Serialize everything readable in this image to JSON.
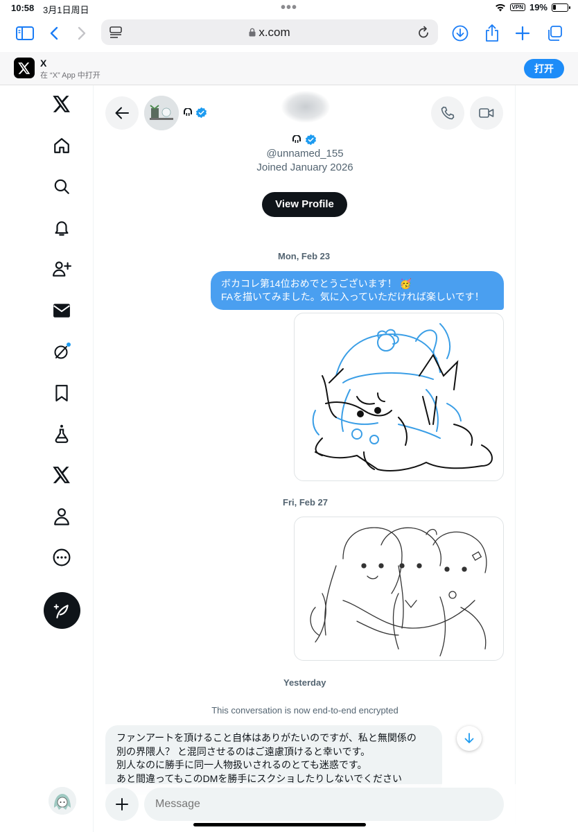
{
  "status": {
    "time": "10:58",
    "date": "3月1日周日",
    "vpn": "VPN",
    "battery": "19%"
  },
  "browser": {
    "url": "x.com"
  },
  "banner": {
    "app_name": "X",
    "subtitle": "在 “X” App 中打开",
    "open_label": "打开"
  },
  "sidebar": {
    "items": [
      "x-logo",
      "home",
      "search",
      "notifications",
      "follow",
      "messages",
      "grok",
      "bookmarks",
      "labs",
      "premium",
      "profile",
      "more"
    ]
  },
  "conversation": {
    "handle": "@unnamed_155",
    "joined": "Joined January 2026",
    "view_profile": "View Profile",
    "dates": {
      "first": "Mon, Feb 23",
      "second": "Fri, Feb 27",
      "third": "Yesterday"
    },
    "sent_message": {
      "line1": "ボカコレ第14位おめでとうございます！ 🥳",
      "line2": "FAを描いてみました。気に入っていただければ楽しいです！"
    },
    "encryption_notice": "This conversation is now end-to-end encrypted",
    "received_message": {
      "line1": "ファンアートを頂けること自体はありがたいのですが、私と無関係の",
      "line2": "別の界隈人？ と混同させるのはご遠慮頂けると幸いです。",
      "line3": "別人なのに勝手に同一人物扱いされるのとても迷惑です。",
      "line4": "あと間違ってもこのDMを勝手にスクショしたりしないでください"
    },
    "composer_placeholder": "Message"
  },
  "colors": {
    "accent": "#1d9bf0",
    "sent_bubble": "#4a9ff0",
    "text_primary": "#0f1419",
    "text_secondary": "#536471"
  }
}
